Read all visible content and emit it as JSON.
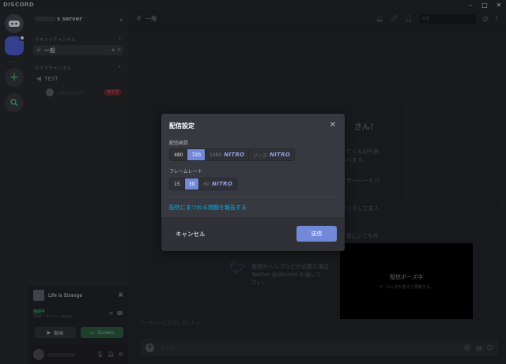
{
  "app": {
    "brand": "DISCORD",
    "window_controls": [
      "–",
      "□",
      "✕"
    ]
  },
  "server": {
    "name": "s server"
  },
  "categories": {
    "text": "テキストチャンネル",
    "voice": "ボイスチャンネル"
  },
  "channels": {
    "text_channel": "一般",
    "voice_channel": "TEST",
    "live_badge": "ライブ"
  },
  "rich_presence": {
    "game": "Life is Strange",
    "connection": "接続中",
    "connection_sub": "TEST / サーバー server"
  },
  "buttons": {
    "video": "動画",
    "screen": "Screen"
  },
  "chat": {
    "channel_name": "一般",
    "search_placeholder": "検索"
  },
  "background": {
    "welcome_title": "さん！",
    "line1": "がってくる初円表",
    "line2": "で手べます。",
    "line3": "クにサーバーを力",
    "line4": "クリックして友人",
    "line5": "て、家にいても外",
    "help1": "質問やヘルプなどが必要な場合",
    "help2": "Twitter @discord を通して",
    "help3": "さい。",
    "new_msg": "パーティーに参加しましたよ。"
  },
  "stream_pause": {
    "title": "配信ポーズ中",
    "subtitle": "ゲームに切り替えて再開する。"
  },
  "composer": {
    "placeholder": "#一般へ"
  },
  "modal": {
    "title": "配信設定",
    "resolution_label": "配信画質",
    "resolution_options": {
      "r480": "480",
      "r720": "720",
      "r1080": "1080",
      "source": "ソース"
    },
    "framerate_label": "フレームレート",
    "framerate_options": {
      "f15": "15",
      "f30": "30",
      "f60": "60"
    },
    "nitro_label": "NITRO",
    "report_link": "配信にまつわる問題を報告する",
    "cancel": "キャンセル",
    "send": "送信"
  },
  "colors": {
    "accent": "#7289da",
    "link": "#00b0f4",
    "live": "#ed4245",
    "online": "#3ba55d"
  },
  "selected": {
    "resolution": "720",
    "framerate": "30"
  }
}
